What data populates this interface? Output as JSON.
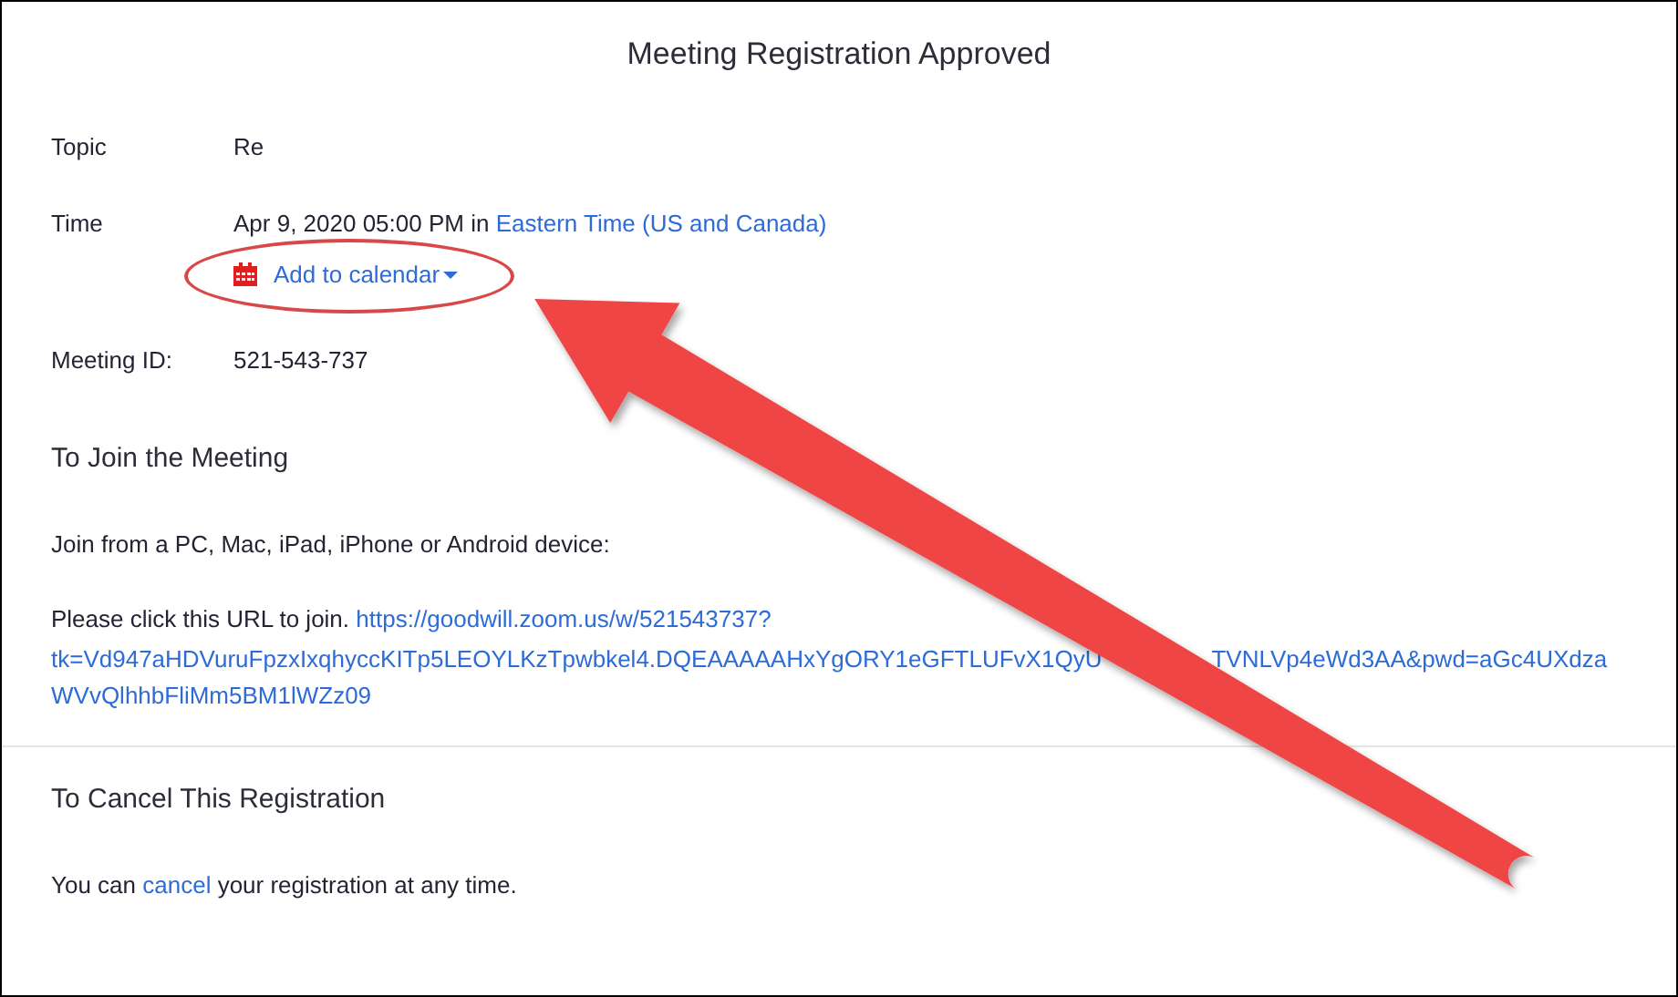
{
  "title": "Meeting Registration Approved",
  "topic": {
    "label": "Topic",
    "value": "Re"
  },
  "time": {
    "label": "Time",
    "value": "Apr 9, 2020 05:00 PM in",
    "timezone": "Eastern Time (US and Canada)",
    "calendar_link": "Add to calendar"
  },
  "meeting_id": {
    "label": "Meeting ID:",
    "value": "521-543-737"
  },
  "join": {
    "heading": "To Join the Meeting",
    "devices": "Join from a PC, Mac, iPad, iPhone or Android device:",
    "prompt": "Please click this URL to join.",
    "url_parts": [
      "https://goodwill.zoom.us/w/521543737?",
      "tk=Vd947aHDVuruFpzxIxqhyccKITp5LEOYLKzTpwbkel4.DQEAAAAAHxYgORY1eGFTLUFvX1QyU",
      "TVNLVp4eWd3AA&pwd=aGc4UXdza",
      "WVvQlhhbFliMm5BM1lWZz09"
    ]
  },
  "cancel": {
    "heading": "To Cancel This Registration",
    "text_before": "You can",
    "link": "cancel",
    "text_after": "your registration at any time."
  }
}
